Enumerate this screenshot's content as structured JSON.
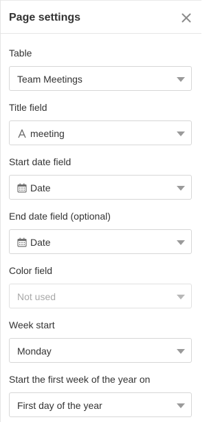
{
  "header": {
    "title": "Page settings",
    "close_icon": "close-icon"
  },
  "fields": {
    "table": {
      "label": "Table",
      "value": "Team Meetings"
    },
    "title_field": {
      "label": "Title field",
      "value": "meeting",
      "icon": "text-field-icon"
    },
    "start_date": {
      "label": "Start date field",
      "value": "Date",
      "icon": "calendar-icon"
    },
    "end_date": {
      "label": "End date field (optional)",
      "value": "Date",
      "icon": "calendar-icon"
    },
    "color_field": {
      "label": "Color field",
      "placeholder": "Not used"
    },
    "week_start": {
      "label": "Week start",
      "value": "Monday"
    },
    "first_week": {
      "label": "Start the first week of the year on",
      "value": "First day of the year"
    }
  },
  "colors": {
    "text": "#333333",
    "border": "#d6d6d6",
    "placeholder": "#a8a8a8",
    "caret": "#9a9a9a"
  }
}
